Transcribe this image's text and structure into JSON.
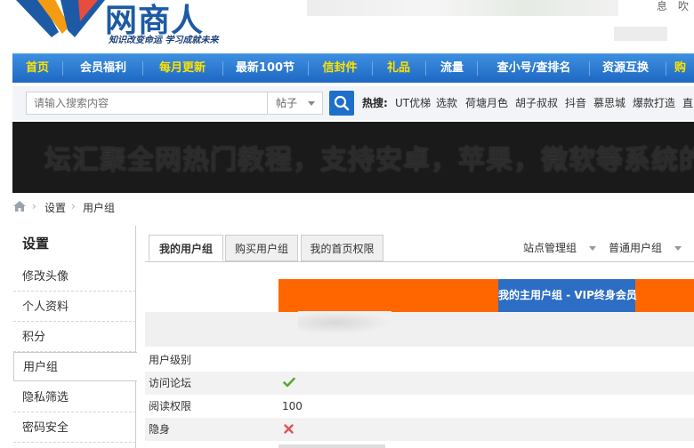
{
  "header": {
    "logo_text": "网商人",
    "logo_slogan": "知识改变命运  学习成就未来",
    "top_right_text": "息",
    "top_right_text2": "吹"
  },
  "nav": {
    "items": [
      {
        "label": "首页",
        "highlight": true
      },
      {
        "label": "会员福利",
        "highlight": false
      },
      {
        "label": "每月更新",
        "highlight": true
      },
      {
        "label": "最新100节",
        "highlight": false
      },
      {
        "label": "信封件",
        "highlight": true
      },
      {
        "label": "礼品",
        "highlight": true
      },
      {
        "label": "流量",
        "highlight": false
      },
      {
        "label": "查小号/查排名",
        "highlight": false
      },
      {
        "label": "资源互换",
        "highlight": false
      },
      {
        "label": "购",
        "highlight": true
      }
    ]
  },
  "search": {
    "placeholder": "请输入搜索内容",
    "type_value": "帖子",
    "hot_label": "热搜:",
    "hot_links": [
      "UT优梯",
      "选款",
      "荷塘月色",
      "胡子叔叔",
      "抖音",
      "慕思城",
      "爆款打造",
      "直"
    ]
  },
  "banner": {
    "text": "坛汇聚全网热门教程，支持安卓，苹果，微软等系统的软"
  },
  "breadcrumb": {
    "items": [
      "设置",
      "用户组"
    ]
  },
  "sidebar": {
    "title": "设置",
    "items": [
      {
        "label": "修改头像",
        "active": false
      },
      {
        "label": "个人资料",
        "active": false
      },
      {
        "label": "积分",
        "active": false
      },
      {
        "label": "用户组",
        "active": true
      },
      {
        "label": "隐私筛选",
        "active": false
      },
      {
        "label": "密码安全",
        "active": false
      }
    ]
  },
  "tabs": [
    {
      "label": "我的用户组",
      "active": true
    },
    {
      "label": "购买用户组",
      "active": false
    },
    {
      "label": "我的首页权限",
      "active": false
    }
  ],
  "group_dropdowns": [
    "站点管理组",
    "普通用户组"
  ],
  "usergroup": {
    "header_label": "我的主用户组 - VIP终身会员",
    "rows": [
      {
        "label": "用户级别",
        "value": "",
        "icon": ""
      },
      {
        "label": "访问论坛",
        "value": "",
        "icon": "check-icon"
      },
      {
        "label": "阅读权限",
        "value": "100",
        "icon": ""
      },
      {
        "label": "隐身",
        "value": "",
        "icon": "cross-icon"
      }
    ]
  },
  "colors": {
    "nav_blue": "#1e68c3",
    "nav_highlight": "#ffe200",
    "orange": "#ff6600",
    "header_blue": "#2d6ec5",
    "check_green": "#5aa832",
    "cross_red": "#e05555"
  }
}
